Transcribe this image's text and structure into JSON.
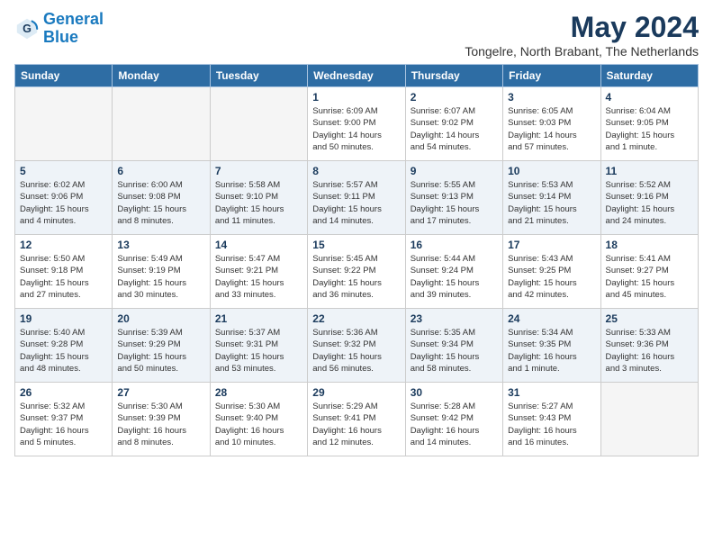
{
  "logo": {
    "line1": "General",
    "line2": "Blue"
  },
  "title": "May 2024",
  "location": "Tongelre, North Brabant, The Netherlands",
  "weekdays": [
    "Sunday",
    "Monday",
    "Tuesday",
    "Wednesday",
    "Thursday",
    "Friday",
    "Saturday"
  ],
  "weeks": [
    [
      {
        "day": "",
        "info": ""
      },
      {
        "day": "",
        "info": ""
      },
      {
        "day": "",
        "info": ""
      },
      {
        "day": "1",
        "info": "Sunrise: 6:09 AM\nSunset: 9:00 PM\nDaylight: 14 hours\nand 50 minutes."
      },
      {
        "day": "2",
        "info": "Sunrise: 6:07 AM\nSunset: 9:02 PM\nDaylight: 14 hours\nand 54 minutes."
      },
      {
        "day": "3",
        "info": "Sunrise: 6:05 AM\nSunset: 9:03 PM\nDaylight: 14 hours\nand 57 minutes."
      },
      {
        "day": "4",
        "info": "Sunrise: 6:04 AM\nSunset: 9:05 PM\nDaylight: 15 hours\nand 1 minute."
      }
    ],
    [
      {
        "day": "5",
        "info": "Sunrise: 6:02 AM\nSunset: 9:06 PM\nDaylight: 15 hours\nand 4 minutes."
      },
      {
        "day": "6",
        "info": "Sunrise: 6:00 AM\nSunset: 9:08 PM\nDaylight: 15 hours\nand 8 minutes."
      },
      {
        "day": "7",
        "info": "Sunrise: 5:58 AM\nSunset: 9:10 PM\nDaylight: 15 hours\nand 11 minutes."
      },
      {
        "day": "8",
        "info": "Sunrise: 5:57 AM\nSunset: 9:11 PM\nDaylight: 15 hours\nand 14 minutes."
      },
      {
        "day": "9",
        "info": "Sunrise: 5:55 AM\nSunset: 9:13 PM\nDaylight: 15 hours\nand 17 minutes."
      },
      {
        "day": "10",
        "info": "Sunrise: 5:53 AM\nSunset: 9:14 PM\nDaylight: 15 hours\nand 21 minutes."
      },
      {
        "day": "11",
        "info": "Sunrise: 5:52 AM\nSunset: 9:16 PM\nDaylight: 15 hours\nand 24 minutes."
      }
    ],
    [
      {
        "day": "12",
        "info": "Sunrise: 5:50 AM\nSunset: 9:18 PM\nDaylight: 15 hours\nand 27 minutes."
      },
      {
        "day": "13",
        "info": "Sunrise: 5:49 AM\nSunset: 9:19 PM\nDaylight: 15 hours\nand 30 minutes."
      },
      {
        "day": "14",
        "info": "Sunrise: 5:47 AM\nSunset: 9:21 PM\nDaylight: 15 hours\nand 33 minutes."
      },
      {
        "day": "15",
        "info": "Sunrise: 5:45 AM\nSunset: 9:22 PM\nDaylight: 15 hours\nand 36 minutes."
      },
      {
        "day": "16",
        "info": "Sunrise: 5:44 AM\nSunset: 9:24 PM\nDaylight: 15 hours\nand 39 minutes."
      },
      {
        "day": "17",
        "info": "Sunrise: 5:43 AM\nSunset: 9:25 PM\nDaylight: 15 hours\nand 42 minutes."
      },
      {
        "day": "18",
        "info": "Sunrise: 5:41 AM\nSunset: 9:27 PM\nDaylight: 15 hours\nand 45 minutes."
      }
    ],
    [
      {
        "day": "19",
        "info": "Sunrise: 5:40 AM\nSunset: 9:28 PM\nDaylight: 15 hours\nand 48 minutes."
      },
      {
        "day": "20",
        "info": "Sunrise: 5:39 AM\nSunset: 9:29 PM\nDaylight: 15 hours\nand 50 minutes."
      },
      {
        "day": "21",
        "info": "Sunrise: 5:37 AM\nSunset: 9:31 PM\nDaylight: 15 hours\nand 53 minutes."
      },
      {
        "day": "22",
        "info": "Sunrise: 5:36 AM\nSunset: 9:32 PM\nDaylight: 15 hours\nand 56 minutes."
      },
      {
        "day": "23",
        "info": "Sunrise: 5:35 AM\nSunset: 9:34 PM\nDaylight: 15 hours\nand 58 minutes."
      },
      {
        "day": "24",
        "info": "Sunrise: 5:34 AM\nSunset: 9:35 PM\nDaylight: 16 hours\nand 1 minute."
      },
      {
        "day": "25",
        "info": "Sunrise: 5:33 AM\nSunset: 9:36 PM\nDaylight: 16 hours\nand 3 minutes."
      }
    ],
    [
      {
        "day": "26",
        "info": "Sunrise: 5:32 AM\nSunset: 9:37 PM\nDaylight: 16 hours\nand 5 minutes."
      },
      {
        "day": "27",
        "info": "Sunrise: 5:30 AM\nSunset: 9:39 PM\nDaylight: 16 hours\nand 8 minutes."
      },
      {
        "day": "28",
        "info": "Sunrise: 5:30 AM\nSunset: 9:40 PM\nDaylight: 16 hours\nand 10 minutes."
      },
      {
        "day": "29",
        "info": "Sunrise: 5:29 AM\nSunset: 9:41 PM\nDaylight: 16 hours\nand 12 minutes."
      },
      {
        "day": "30",
        "info": "Sunrise: 5:28 AM\nSunset: 9:42 PM\nDaylight: 16 hours\nand 14 minutes."
      },
      {
        "day": "31",
        "info": "Sunrise: 5:27 AM\nSunset: 9:43 PM\nDaylight: 16 hours\nand 16 minutes."
      },
      {
        "day": "",
        "info": ""
      }
    ]
  ]
}
